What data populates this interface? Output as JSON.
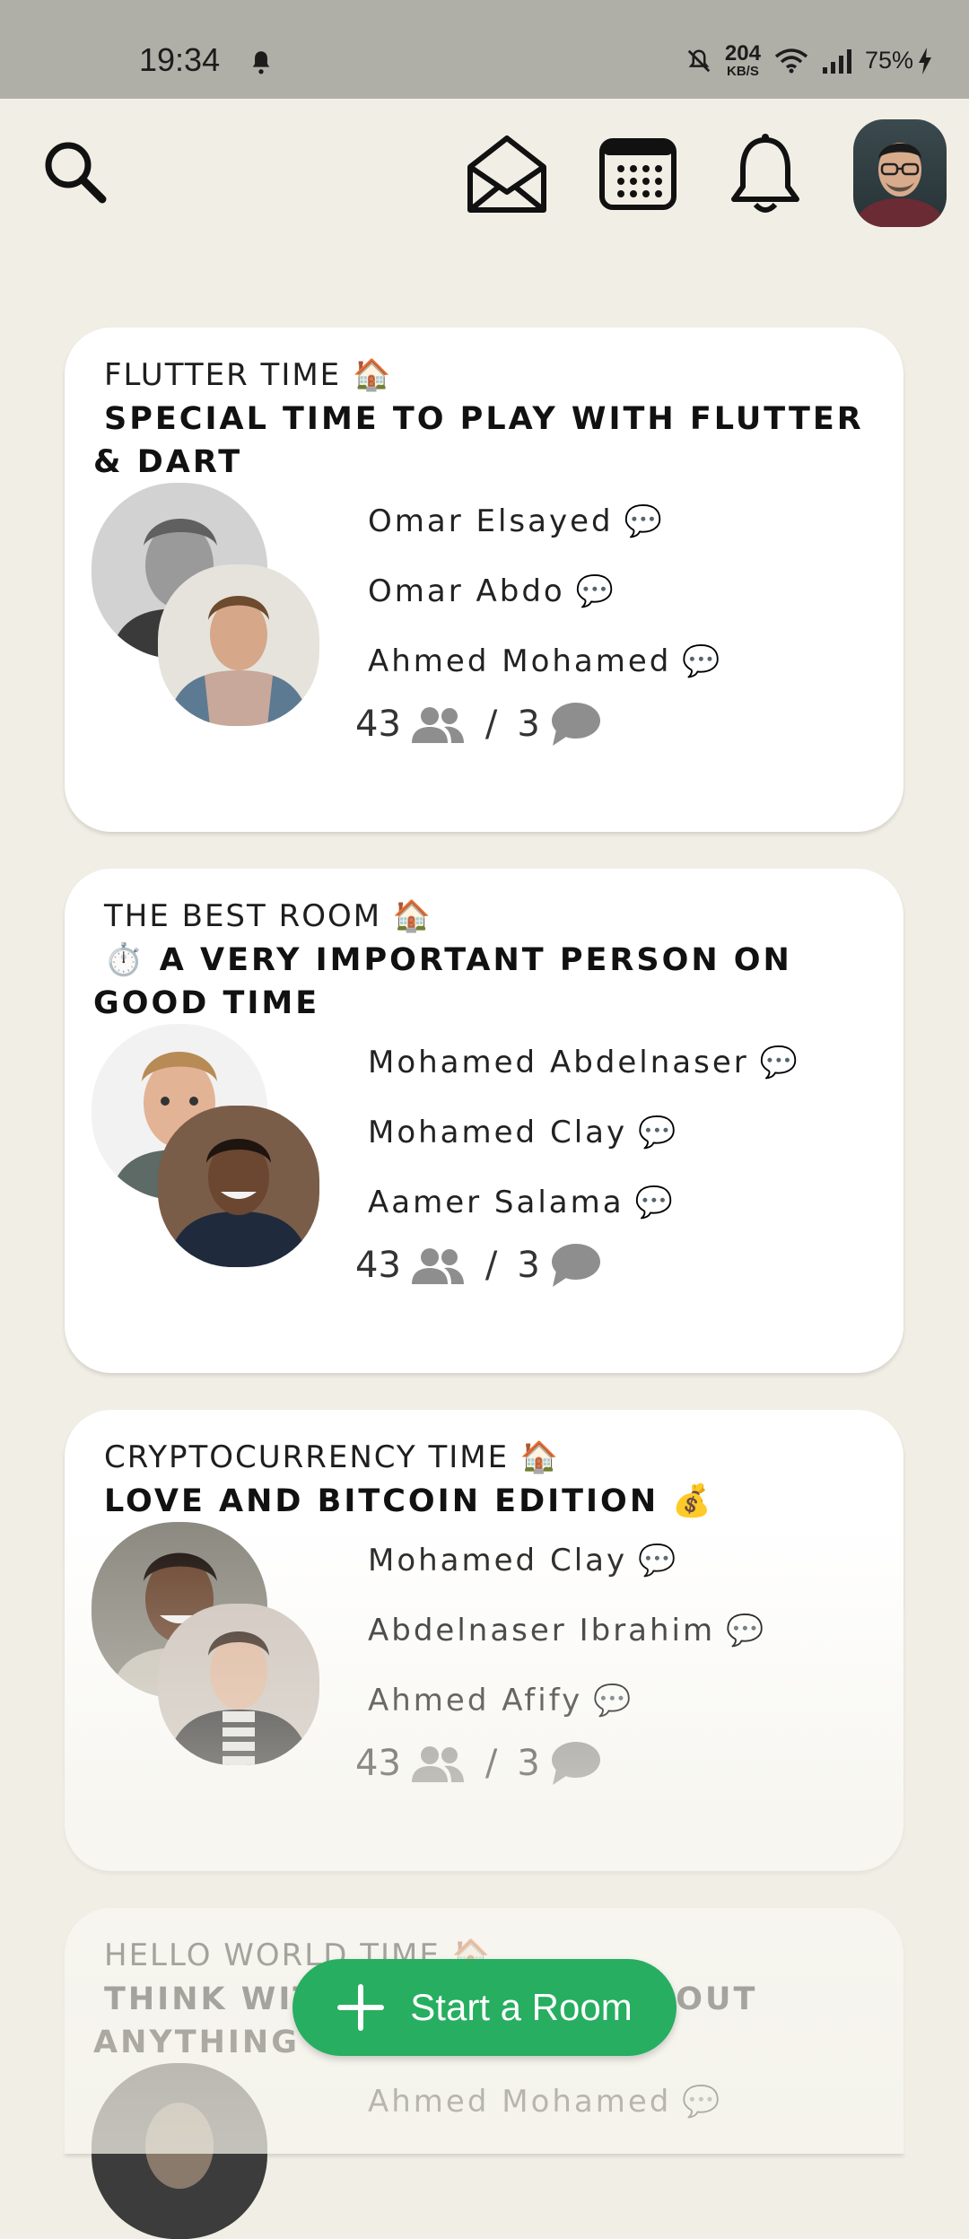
{
  "status_bar": {
    "time": "19:34",
    "speed_value": "204",
    "speed_unit": "KB/S",
    "battery": "75%",
    "icons": [
      "alarm-bell-icon",
      "mute-icon",
      "wifi-icon",
      "signal-icon",
      "charging-icon"
    ]
  },
  "top_nav": {
    "icons": [
      "search-icon",
      "mail-icon",
      "calendar-icon",
      "notification-bell-icon",
      "profile-avatar"
    ]
  },
  "rooms": [
    {
      "club": "FLUTTER TIME 🏠",
      "title_emoji": "",
      "title": "SPECIAL TIME TO PLAY WITH FLUTTER & DART",
      "speakers": [
        "Omar  Elsayed",
        "Omar  Abdo",
        "Ahmed  Mohamed"
      ],
      "listeners": "43",
      "speakers_count": "3"
    },
    {
      "club": "THE BEST ROOM 🏠",
      "title_emoji": "⏱️",
      "title": "A VERY IMPORTANT PERSON ON GOOD TIME",
      "speakers": [
        "Mohamed  Abdelnaser",
        "Mohamed  Clay",
        "Aamer  Salama"
      ],
      "listeners": "43",
      "speakers_count": "3"
    },
    {
      "club": "CRYPTOCURRENCY TIME 🏠",
      "title_emoji": "",
      "title": "LOVE AND BITCOIN EDITION 💰",
      "speakers": [
        "Mohamed  Clay",
        "Abdelnaser  Ibrahim",
        "Ahmed  Afify"
      ],
      "listeners": "43",
      "speakers_count": "3"
    },
    {
      "club": "HELLO WORLD TIME 🏠",
      "title_emoji": "",
      "title": "THINK WIT",
      "title_tail": "OUT",
      "title_line2": "ANYTHING",
      "speakers": [
        "Ahmed  Mohamed"
      ]
    }
  ],
  "fab": {
    "label": "Start a Room"
  },
  "colors": {
    "background": "#f1efe5",
    "card": "#ffffff",
    "accent": "#27ae60",
    "status_bar": "#afafa8"
  }
}
